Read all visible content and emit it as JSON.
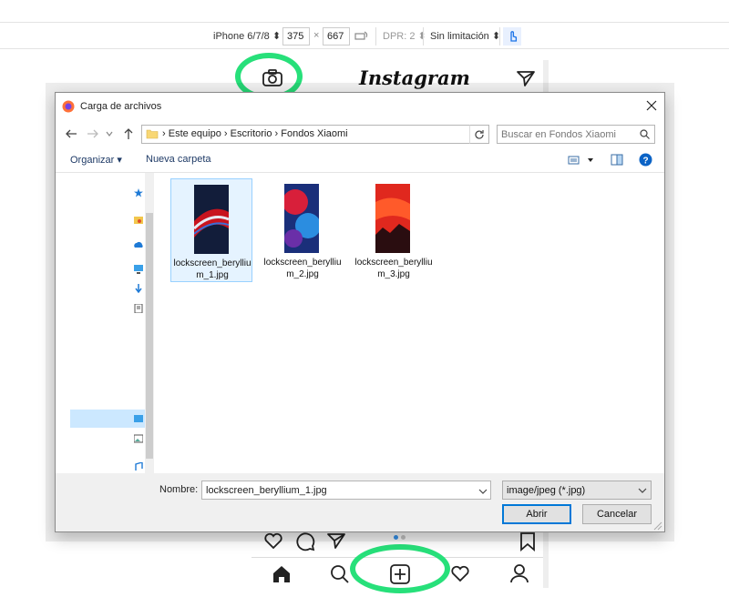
{
  "devtools": {
    "device": "iPhone 6/7/8",
    "width": "375",
    "times": "×",
    "height": "667",
    "dpr": "DPR: 2",
    "throttle": "Sin limitación"
  },
  "instagram": {
    "logo": "Instagram"
  },
  "dialog": {
    "title": "Carga de archivos",
    "breadcrumb": [
      "Este equipo",
      "Escritorio",
      "Fondos Xiaomi"
    ],
    "search_placeholder": "Buscar en Fondos Xiaomi",
    "organize": "Organizar",
    "new_folder": "Nueva carpeta",
    "files": [
      {
        "name": "lockscreen_beryllium_1.jpg"
      },
      {
        "name": "lockscreen_beryllium_2.jpg"
      },
      {
        "name": "lockscreen_beryllium_3.jpg"
      }
    ],
    "name_label": "Nombre:",
    "name_value": "lockscreen_beryllium_1.jpg",
    "filetype": "image/jpeg (*.jpg)",
    "open_button": "Abrir",
    "cancel_button": "Cancelar"
  },
  "colors": {
    "highlight": "#27e07a",
    "accent": "#0078d7"
  }
}
